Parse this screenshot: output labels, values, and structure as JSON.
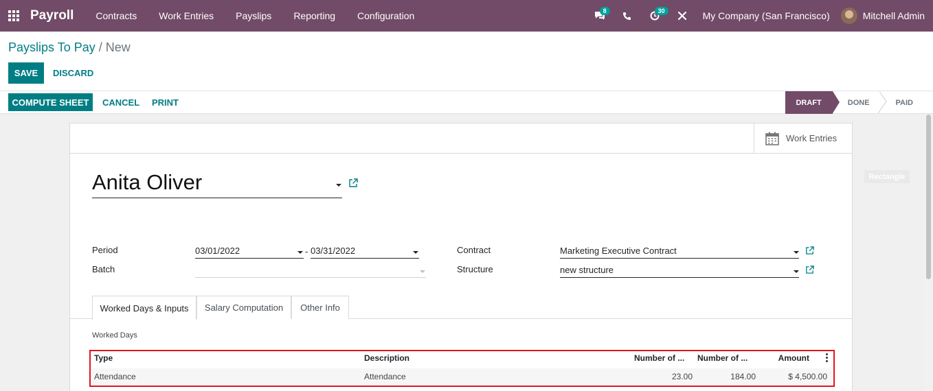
{
  "navbar": {
    "app_name": "Payroll",
    "menu": [
      "Contracts",
      "Work Entries",
      "Payslips",
      "Reporting",
      "Configuration"
    ],
    "messages_count": "8",
    "activities_count": "30",
    "company": "My Company (San Francisco)",
    "user": "Mitchell Admin"
  },
  "breadcrumb": {
    "parent": "Payslips To Pay",
    "separator": "/",
    "current": "New"
  },
  "actions": {
    "save": "SAVE",
    "discard": "DISCARD"
  },
  "statusbar": {
    "buttons": {
      "compute": "COMPUTE SHEET",
      "cancel": "CANCEL",
      "print": "PRINT"
    },
    "stages": [
      "DRAFT",
      "DONE",
      "PAID"
    ],
    "active_stage": "DRAFT"
  },
  "smart_button": {
    "label": "Work Entries",
    "icon": "calendar-icon"
  },
  "employee": "Anita Oliver",
  "form": {
    "period_label": "Period",
    "period_from": "03/01/2022",
    "period_sep": "-",
    "period_to": "03/31/2022",
    "batch_label": "Batch",
    "batch_value": "",
    "contract_label": "Contract",
    "contract_value": "Marketing Executive Contract",
    "structure_label": "Structure",
    "structure_value": "new structure"
  },
  "tabs": [
    "Worked Days & Inputs",
    "Salary Computation",
    "Other Info"
  ],
  "worked_days": {
    "title": "Worked Days",
    "columns": [
      "Type",
      "Description",
      "Number of ...",
      "Number of ...",
      "Amount"
    ],
    "rows": [
      {
        "type": "Attendance",
        "description": "Attendance",
        "days": "23.00",
        "hours": "184.00",
        "amount": "$ 4,500.00"
      }
    ]
  },
  "overlay_tag": "Rectangle",
  "colors": {
    "brand": "#714B67",
    "primary": "#017e84",
    "highlight_border": "#e0141e"
  }
}
